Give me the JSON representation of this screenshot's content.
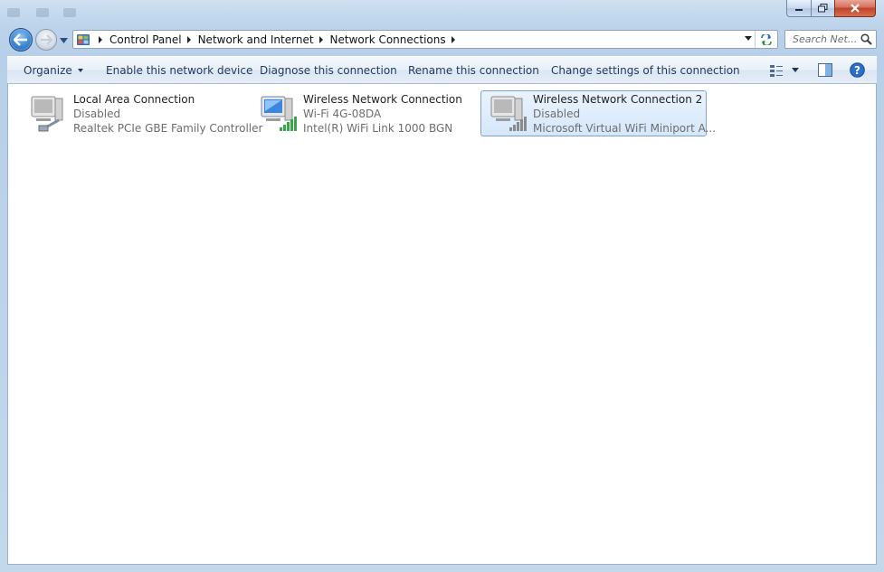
{
  "window": {
    "breadcrumb": [
      "Control Panel",
      "Network and Internet",
      "Network Connections"
    ],
    "search_placeholder": "Search Net...",
    "icons": {
      "back": "back-arrow-icon",
      "forward": "forward-arrow-icon",
      "refresh": "refresh-icon",
      "search": "search-icon"
    }
  },
  "toolbar": {
    "organize": "Organize",
    "enable": "Enable this network device",
    "diagnose": "Diagnose this connection",
    "rename": "Rename this connection",
    "change_settings": "Change settings of this connection",
    "icons": [
      "change-view-icon",
      "preview-pane-icon",
      "help-icon"
    ]
  },
  "connections": [
    {
      "name": "Local Area Connection",
      "status": "Disabled",
      "device": "Realtek PCIe GBE Family Controller",
      "icon": "wired-network-icon",
      "selected": false
    },
    {
      "name": "Wireless Network Connection",
      "status": "Wi-Fi 4G-08DA",
      "device": "Intel(R) WiFi Link 1000 BGN",
      "icon": "wireless-network-icon",
      "selected": false
    },
    {
      "name": "Wireless Network Connection 2",
      "status": "Disabled",
      "device": "Microsoft Virtual WiFi Miniport A...",
      "icon": "wireless-network-disabled-icon",
      "selected": true
    }
  ],
  "colors": {
    "accent": "#1e395b",
    "selection": "#d5e7fb",
    "signal_active": "#3aa64a",
    "signal_disabled": "#8a8a8a"
  }
}
